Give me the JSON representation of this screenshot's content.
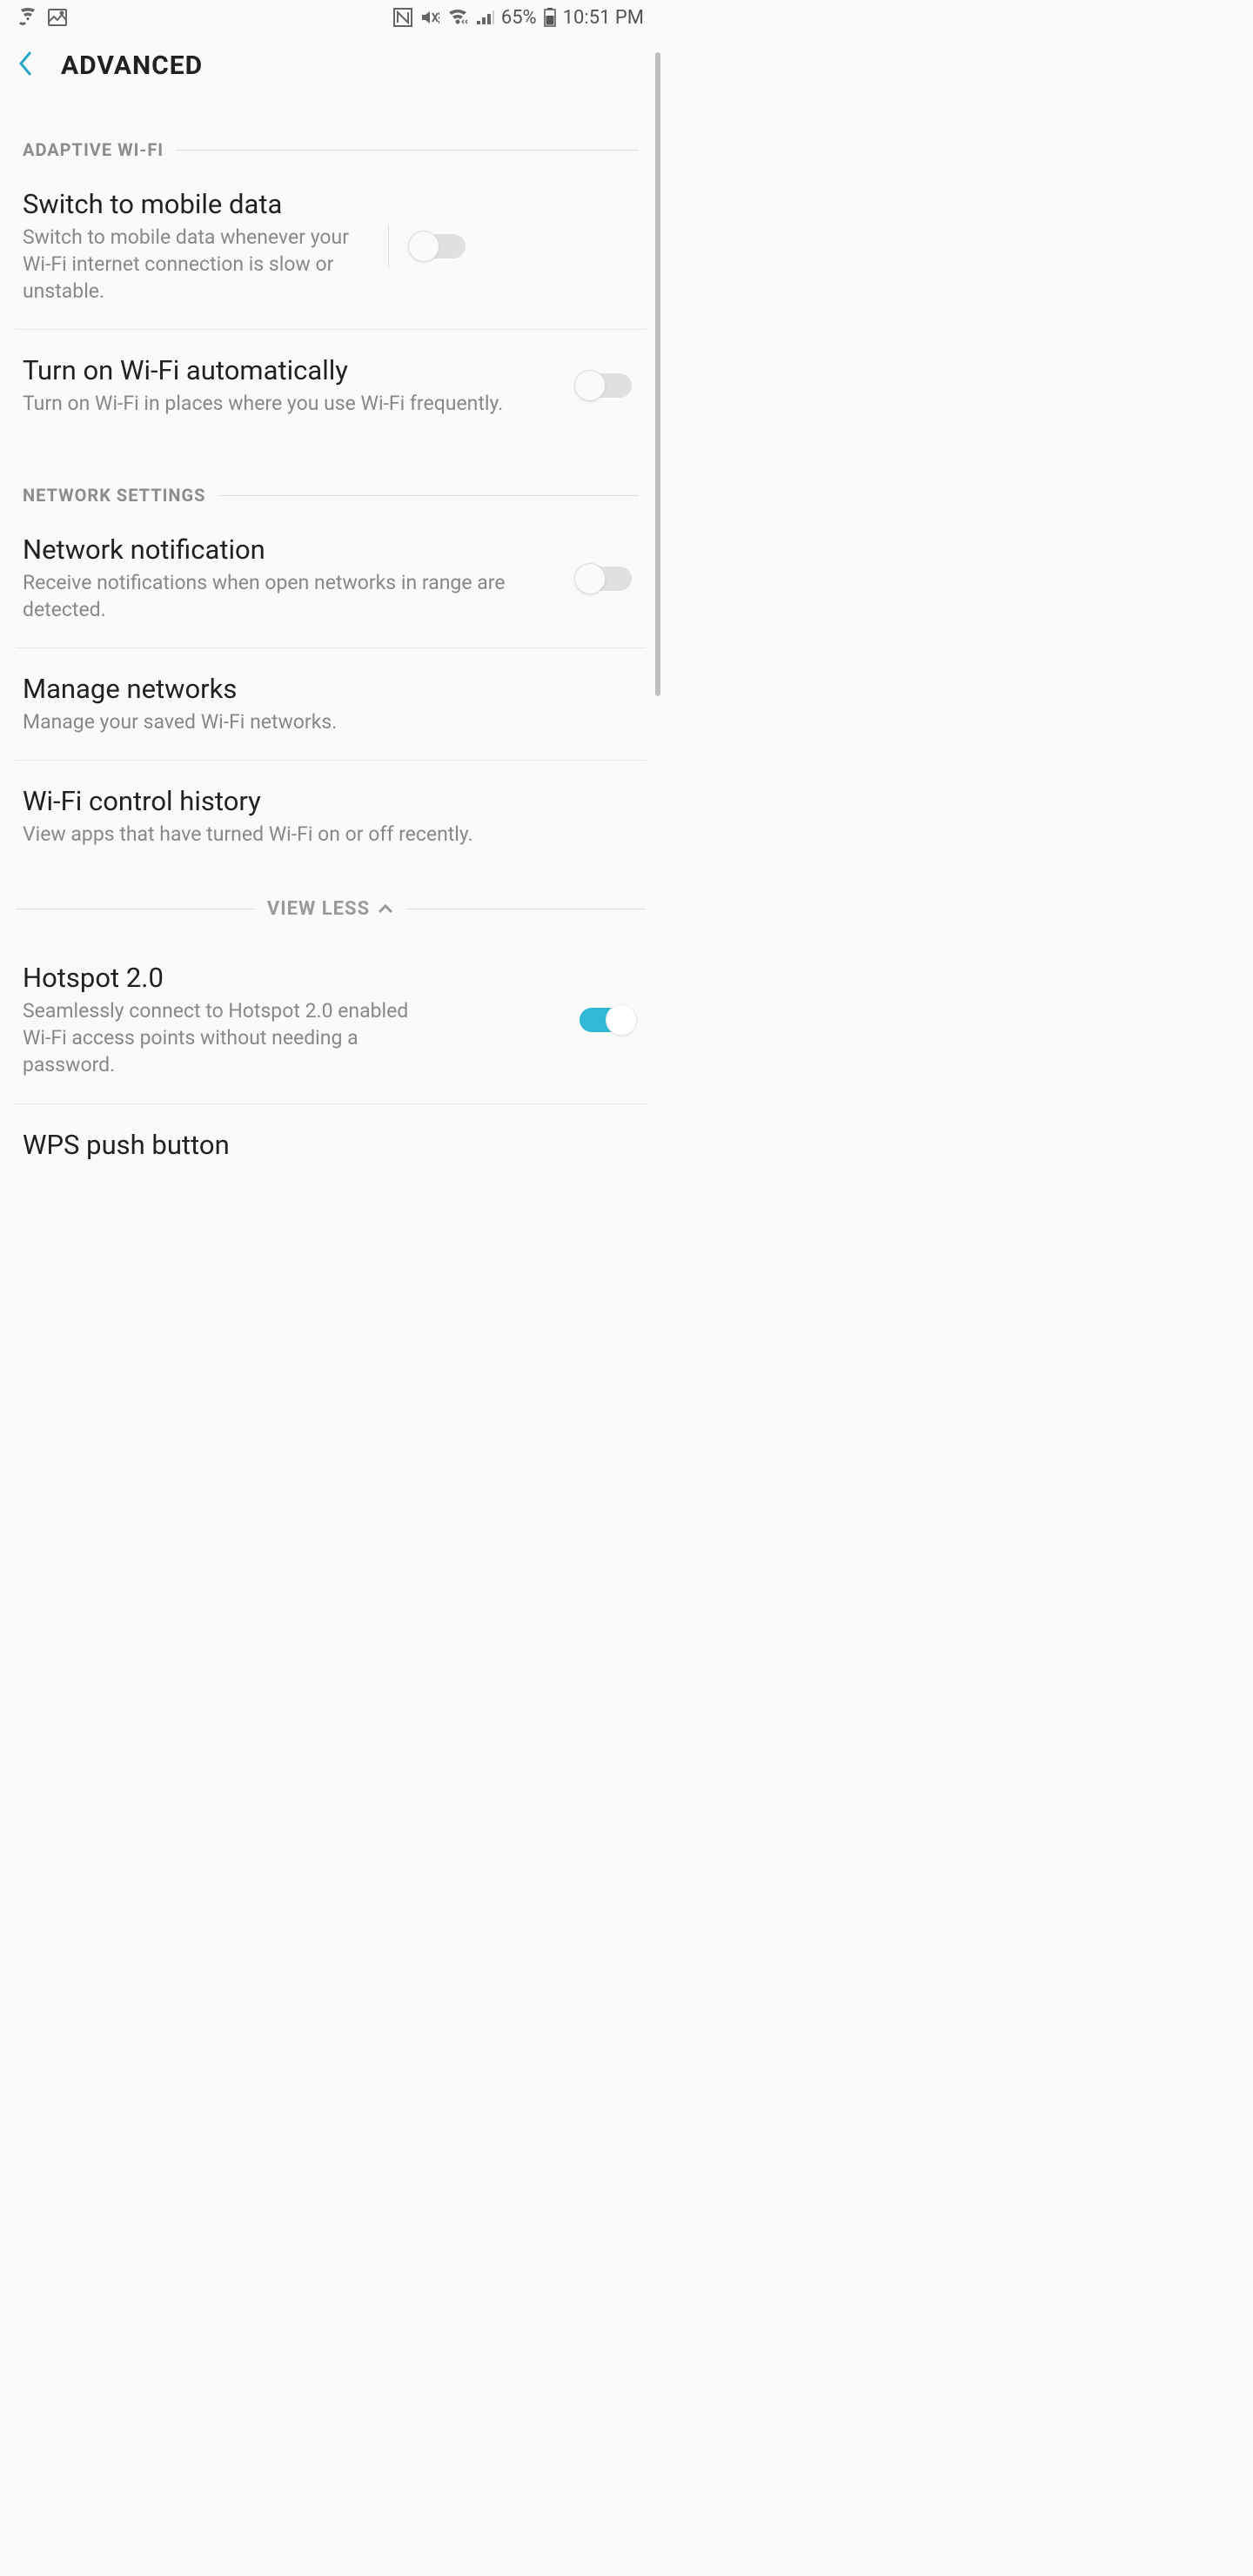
{
  "status": {
    "battery": "65%",
    "time": "10:51 PM"
  },
  "appbar": {
    "title": "ADVANCED"
  },
  "sections": {
    "adaptive": {
      "label": "ADAPTIVE WI-FI"
    },
    "network": {
      "label": "NETWORK SETTINGS"
    }
  },
  "settings": {
    "switch_mobile": {
      "title": "Switch to mobile data",
      "desc": "Switch to mobile data whenever your Wi-Fi internet connection is slow or unstable."
    },
    "auto_wifi": {
      "title": "Turn on Wi-Fi automatically",
      "desc": "Turn on Wi-Fi in places where you use Wi-Fi frequently."
    },
    "net_notify": {
      "title": "Network notification",
      "desc": "Receive notifications when open networks in range are detected."
    },
    "manage_net": {
      "title": "Manage networks",
      "desc": "Manage your saved Wi-Fi networks."
    },
    "wifi_history": {
      "title": "Wi-Fi control history",
      "desc": "View apps that have turned Wi-Fi on or off recently."
    },
    "hotspot20": {
      "title": "Hotspot 2.0",
      "desc": "Seamlessly connect to Hotspot 2.0 enabled Wi-Fi access points without needing a password."
    },
    "wps_push": {
      "title": "WPS push button"
    }
  },
  "view_less": "VIEW LESS"
}
